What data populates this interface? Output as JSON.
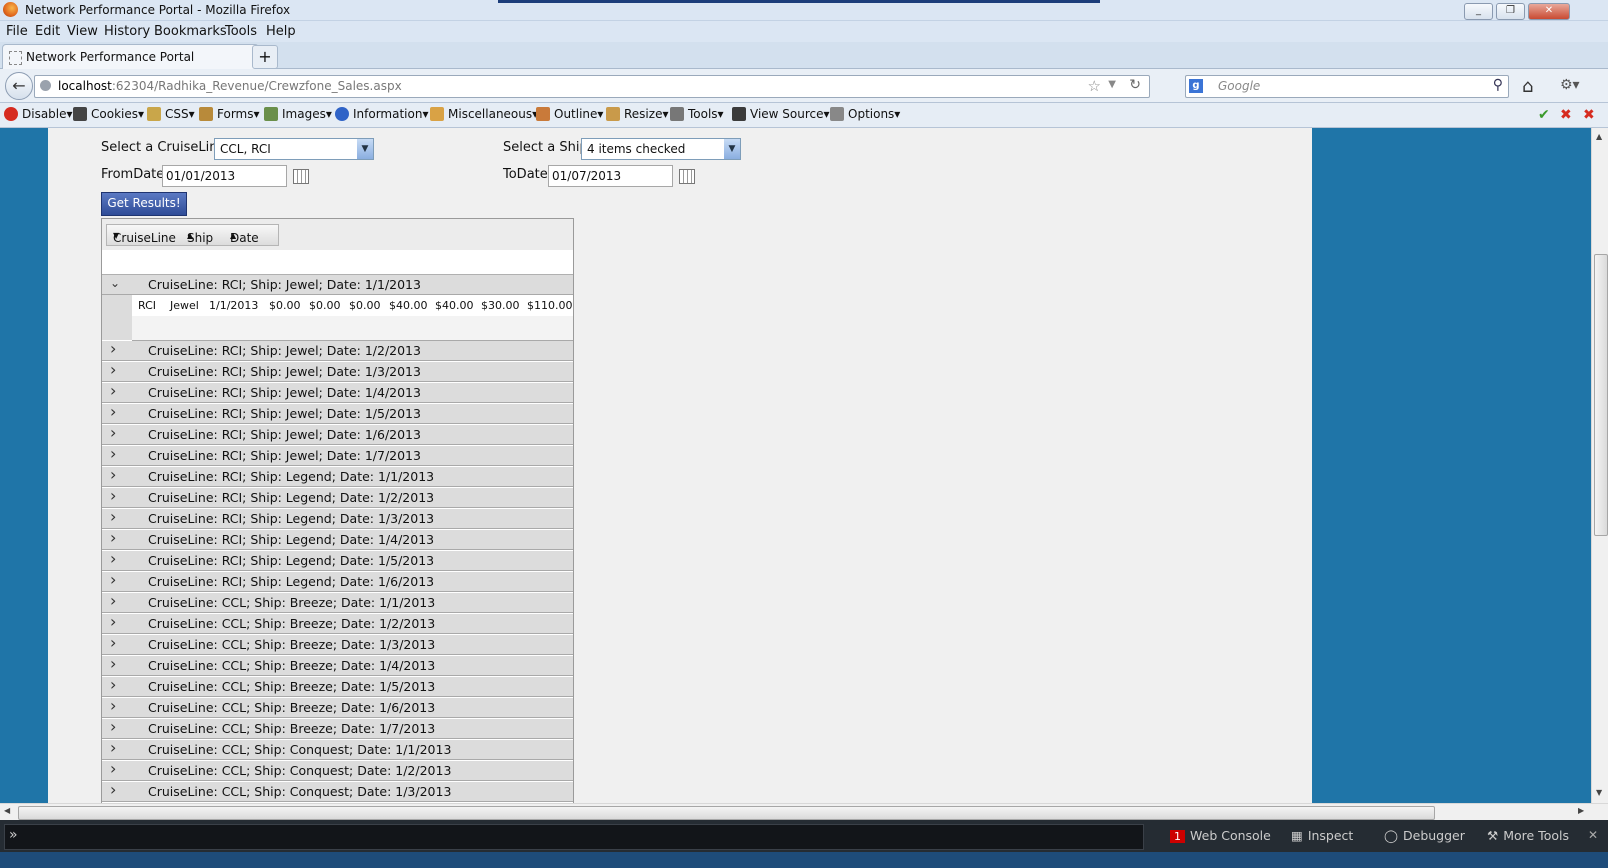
{
  "window": {
    "title": "Network Performance Portal - Mozilla Firefox",
    "buttons": [
      "_",
      "❐",
      "✕"
    ]
  },
  "menu": [
    "File",
    "Edit",
    "View",
    "History",
    "Bookmarks",
    "Tools",
    "Help"
  ],
  "tab": {
    "label": "Network Performance Portal",
    "new_tab": "+"
  },
  "nav": {
    "url_host": "localhost",
    "url_rest": ":62304/Radhika_Revenue/Crewzfone_Sales.aspx",
    "search_placeholder": "Google"
  },
  "devbar": [
    {
      "label": "Disable▾",
      "color": "#d62b1f"
    },
    {
      "label": "Cookies▾",
      "color": "#444444"
    },
    {
      "label": "CSS▾",
      "color": "#c9a64a"
    },
    {
      "label": "Forms▾",
      "color": "#b88a3a"
    },
    {
      "label": "Images▾",
      "color": "#6a8f4a"
    },
    {
      "label": "Information▾",
      "color": "#2f63c7"
    },
    {
      "label": "Miscellaneous▾",
      "color": "#d9a245"
    },
    {
      "label": "Outline▾",
      "color": "#c97a3a"
    },
    {
      "label": "Resize▾",
      "color": "#c99a4a"
    },
    {
      "label": "Tools▾",
      "color": "#777777"
    },
    {
      "label": "View Source▾",
      "color": "#3b3b3b"
    },
    {
      "label": "Options▾",
      "color": "#888888"
    }
  ],
  "form": {
    "cruiseline_label": "Select a CruiseLine:",
    "cruiseline_value": "CCL, RCI",
    "ship_label": "Select a Ship:",
    "ship_value": "4 items checked",
    "fromdate_label": "FromDate:",
    "fromdate_value": "01/01/2013",
    "todate_label": "ToDate:",
    "todate_value": "01/07/2013",
    "submit": "Get Results!"
  },
  "grid": {
    "group_headers": [
      {
        "label": "CruiseLine",
        "sort": "▼"
      },
      {
        "label": "Ship",
        "sort": "▲"
      },
      {
        "label": "Date",
        "sort": "▲"
      }
    ],
    "expanded_group": "CruiseLine: RCI; Ship: Jewel; Date: 1/1/2013",
    "expanded_row": [
      "RCI",
      "Jewel",
      "1/1/2013",
      "$0.00",
      "$0.00",
      "$0.00",
      "$40.00",
      "$40.00",
      "$30.00",
      "$110.00"
    ],
    "collapsed_groups": [
      "CruiseLine: RCI; Ship: Jewel; Date: 1/2/2013",
      "CruiseLine: RCI; Ship: Jewel; Date: 1/3/2013",
      "CruiseLine: RCI; Ship: Jewel; Date: 1/4/2013",
      "CruiseLine: RCI; Ship: Jewel; Date: 1/5/2013",
      "CruiseLine: RCI; Ship: Jewel; Date: 1/6/2013",
      "CruiseLine: RCI; Ship: Jewel; Date: 1/7/2013",
      "CruiseLine: RCI; Ship: Legend; Date: 1/1/2013",
      "CruiseLine: RCI; Ship: Legend; Date: 1/2/2013",
      "CruiseLine: RCI; Ship: Legend; Date: 1/3/2013",
      "CruiseLine: RCI; Ship: Legend; Date: 1/4/2013",
      "CruiseLine: RCI; Ship: Legend; Date: 1/5/2013",
      "CruiseLine: RCI; Ship: Legend; Date: 1/6/2013",
      "CruiseLine: CCL; Ship: Breeze; Date: 1/1/2013",
      "CruiseLine: CCL; Ship: Breeze; Date: 1/2/2013",
      "CruiseLine: CCL; Ship: Breeze; Date: 1/3/2013",
      "CruiseLine: CCL; Ship: Breeze; Date: 1/4/2013",
      "CruiseLine: CCL; Ship: Breeze; Date: 1/5/2013",
      "CruiseLine: CCL; Ship: Breeze; Date: 1/6/2013",
      "CruiseLine: CCL; Ship: Breeze; Date: 1/7/2013",
      "CruiseLine: CCL; Ship: Conquest; Date: 1/1/2013",
      "CruiseLine: CCL; Ship: Conquest; Date: 1/2/2013",
      "CruiseLine: CCL; Ship: Conquest; Date: 1/3/2013"
    ]
  },
  "devtools": {
    "console_count": "1",
    "web_console": "Web Console",
    "inspect": "Inspect",
    "debugger": "Debugger",
    "more_tools": "More Tools"
  },
  "colors": {
    "page_bg": "#1f75a8",
    "accent": "#2f4c97"
  }
}
